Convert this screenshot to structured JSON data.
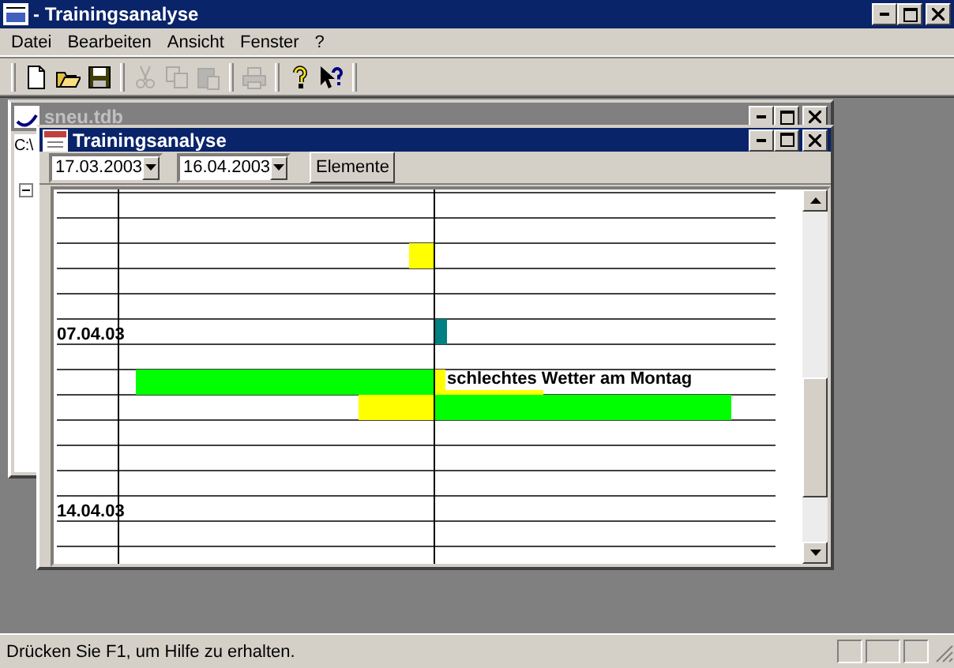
{
  "window": {
    "title": "- Trainingsanalyse"
  },
  "menu": [
    {
      "label": "Datei"
    },
    {
      "label": "Bearbeiten"
    },
    {
      "label": "Ansicht"
    },
    {
      "label": "Fenster"
    },
    {
      "label": "?"
    }
  ],
  "toolbar": [
    {
      "kind": "new",
      "disabled": false
    },
    {
      "kind": "open",
      "disabled": false
    },
    {
      "kind": "save",
      "disabled": false
    },
    {
      "kind": "separator"
    },
    {
      "kind": "cut",
      "disabled": true
    },
    {
      "kind": "copy",
      "disabled": true
    },
    {
      "kind": "paste",
      "disabled": true
    },
    {
      "kind": "separator"
    },
    {
      "kind": "print",
      "disabled": true
    },
    {
      "kind": "separator"
    },
    {
      "kind": "help",
      "disabled": false
    },
    {
      "kind": "context-help",
      "disabled": false
    }
  ],
  "back_window": {
    "title": "sneu.tdb",
    "tree_root": "C:\\"
  },
  "front_window": {
    "title": "Trainingsanalyse",
    "from_date": "17.03.2003",
    "to_date": "16.04.2003",
    "button": "Elemente",
    "rows": [
      {},
      {},
      {},
      {},
      {},
      {
        "date": "07.04.03"
      },
      {},
      {
        "note": "schlechtes Wetter am Montag"
      },
      {},
      {},
      {},
      {},
      {
        "date": "14.04.03"
      },
      {}
    ]
  },
  "status_bar": {
    "text": "Drücken Sie F1, um Hilfe zu erhalten."
  }
}
